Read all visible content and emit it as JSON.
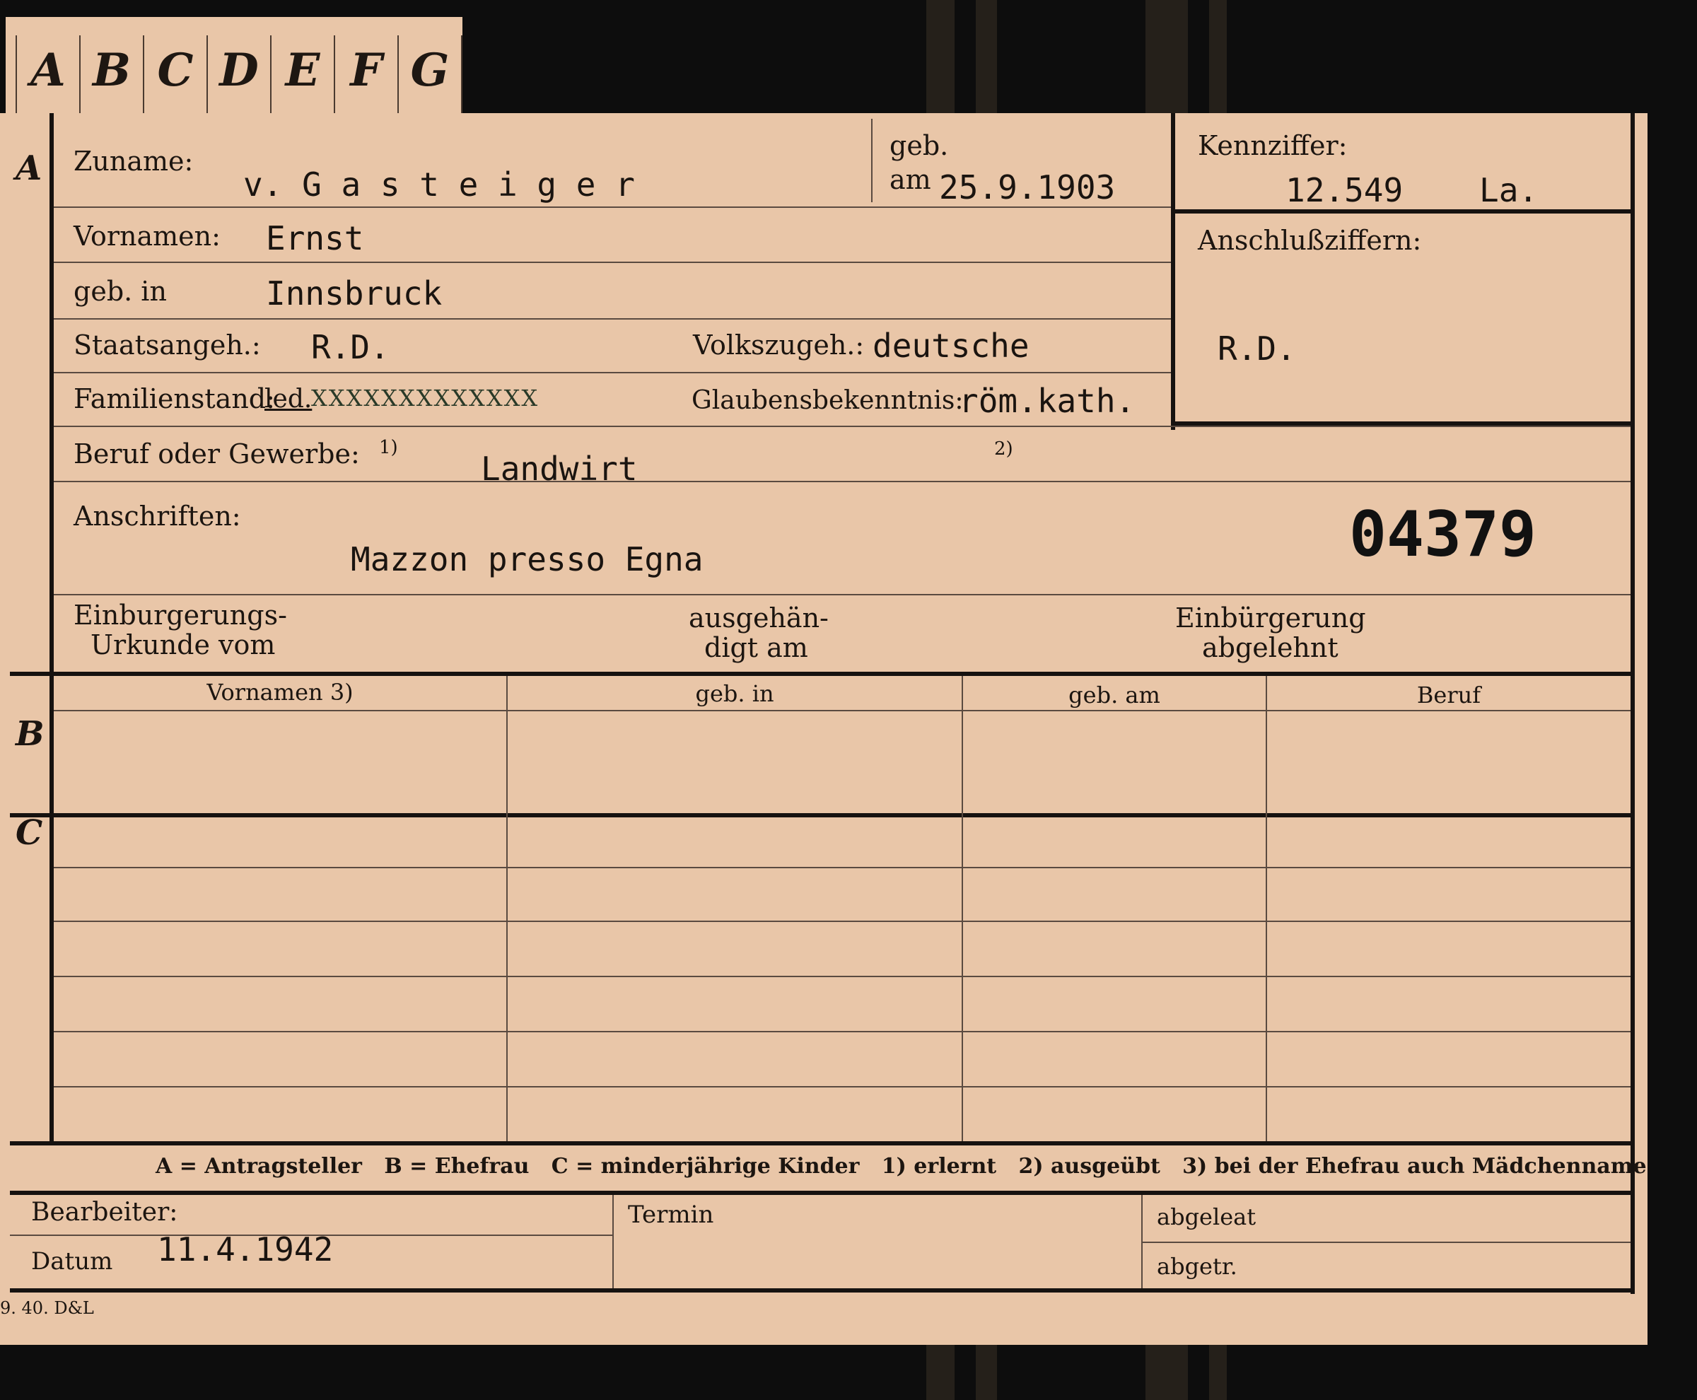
{
  "tabs": [
    "A",
    "B",
    "C",
    "D",
    "E",
    "F",
    "G"
  ],
  "sections": {
    "a": "A",
    "b": "B",
    "c": "C"
  },
  "labels": {
    "zuname": "Zuname:",
    "geb": "geb.",
    "am": "am",
    "kennziffer": "Kennziffer:",
    "vornamen": "Vornamen:",
    "geb_in": "geb. in",
    "anschlussziffern": "Anschlußziffern:",
    "staatsangeh": "Staatsangeh.:",
    "volkszugeh": "Volkszugeh.:",
    "familienstand": "Familienstand:",
    "glaubensbekenntnis": "Glaubensbekenntnis:",
    "beruf_oder_gewerbe": "Beruf oder Gewerbe:",
    "fn1": "1)",
    "fn2": "2)",
    "anschriften": "Anschriften:",
    "einbuergerungs_1": "Einburgerungs-",
    "einbuergerungs_2": "Urkunde vom",
    "ausgehaendigt_1": "ausgehän-",
    "ausgehaendigt_2": "digt am",
    "einbuergerung_1": "Einbürgerung",
    "einbuergerung_2": "abgelehnt",
    "bearbeiter": "Bearbeiter:",
    "datum": "Datum",
    "termin": "Termin",
    "abgelegt": "abgeleat",
    "abgetr": "abgetr."
  },
  "values": {
    "zuname": "v. G a s t e i g e r",
    "geb_am": "25.9.1903",
    "kennziffer": "12.549",
    "kennziffer_suffix": "La.",
    "vornamen": "Ernst",
    "geb_in": "Innsbruck",
    "anschlussziffern": "R.D.",
    "staatsangeh": "R.D.",
    "volkszugeh": "deutsche",
    "familienstand_leading": "led.",
    "familienstand_struck": "XXXXXXXXXXXXX",
    "glaubensbekenntnis": "röm.kath.",
    "beruf": "Landwirt",
    "anschrift": "Mazzon presso Egna",
    "stamp_number": "04379",
    "datum": "11.4.1942"
  },
  "table_headers": [
    "Vornamen 3)",
    "geb. in",
    "geb. am",
    "Beruf"
  ],
  "legend": "A = Antragsteller   B = Ehefrau   C = minderjährige Kinder   1) erlernt   2) ausgeübt   3) bei der Ehefrau auch Mädchenname",
  "print_code": "9. 40. D&L"
}
